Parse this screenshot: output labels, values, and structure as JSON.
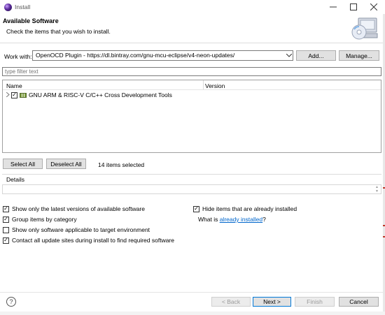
{
  "window": {
    "title": "Install",
    "icon": "eclipse-icon",
    "controls": {
      "minimize": "☐",
      "maximize": "☐",
      "close": "✕"
    }
  },
  "header": {
    "title": "Available Software",
    "description": "Check the items that you wish to install."
  },
  "work_with": {
    "label": "Work with:",
    "value": "OpenOCD Plugin - https://dl.bintray.com/gnu-mcu-eclipse/v4-neon-updates/",
    "add_label": "Add...",
    "manage_label": "Manage..."
  },
  "filter": {
    "placeholder": "type filter text"
  },
  "tree": {
    "columns": [
      "Name",
      "Version"
    ],
    "items": [
      {
        "name": "GNU ARM & RISC-V C/C++ Cross Development Tools",
        "version": "",
        "checked": true,
        "expanded": false
      }
    ]
  },
  "selection": {
    "select_all": "Select All",
    "deselect_all": "Deselect All",
    "count_text": "14 items selected"
  },
  "details": {
    "label": "Details"
  },
  "options": {
    "latest_versions": {
      "label": "Show only the latest versions of available software",
      "checked": true
    },
    "group_by_category": {
      "label": "Group items by category",
      "checked": true
    },
    "target_env": {
      "label": "Show only software applicable to target environment",
      "checked": false
    },
    "contact_sites": {
      "label": "Contact all update sites during install to find required software",
      "checked": true
    },
    "hide_installed": {
      "label": "Hide items that are already installed",
      "checked": true
    },
    "what_is_prefix": "What is ",
    "what_is_link": "already installed",
    "what_is_suffix": "?"
  },
  "footer": {
    "help": "?",
    "back": "< Back",
    "next": "Next >",
    "finish": "Finish",
    "cancel": "Cancel"
  },
  "colors": {
    "link": "#0066cc",
    "primary_border": "#0078d7",
    "button_bg": "#e1e1e1"
  }
}
